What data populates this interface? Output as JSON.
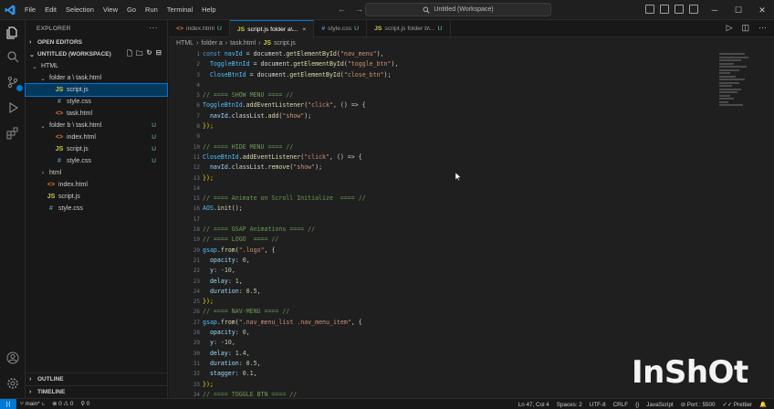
{
  "menu": [
    "File",
    "Edit",
    "Selection",
    "View",
    "Go",
    "Run",
    "Terminal",
    "Help"
  ],
  "command_center": "Untitled (Workspace)",
  "explorer": {
    "title": "EXPLORER",
    "open_editors": "OPEN EDITORS",
    "workspace": "UNTITLED (WORKSPACE)",
    "tree": [
      {
        "label": "HTML",
        "indent": 0,
        "chev": "⌄",
        "icon": "",
        "kind": "",
        "badge": ""
      },
      {
        "label": "folder a \\ task.html",
        "indent": 1,
        "chev": "⌄",
        "icon": "",
        "kind": "",
        "badge": ""
      },
      {
        "label": "script.js",
        "indent": 2,
        "chev": "",
        "icon": "JS",
        "kind": "js",
        "badge": "",
        "selected": true
      },
      {
        "label": "style.css",
        "indent": 2,
        "chev": "",
        "icon": "#",
        "kind": "css",
        "badge": ""
      },
      {
        "label": "task.html",
        "indent": 2,
        "chev": "",
        "icon": "<>",
        "kind": "html",
        "badge": ""
      },
      {
        "label": "folder b \\ task.html",
        "indent": 1,
        "chev": "⌄",
        "icon": "",
        "kind": "",
        "badge": "U"
      },
      {
        "label": "index.html",
        "indent": 2,
        "chev": "",
        "icon": "<>",
        "kind": "html",
        "badge": "U"
      },
      {
        "label": "script.js",
        "indent": 2,
        "chev": "",
        "icon": "JS",
        "kind": "js",
        "badge": "U"
      },
      {
        "label": "style.css",
        "indent": 2,
        "chev": "",
        "icon": "#",
        "kind": "css",
        "badge": "U"
      },
      {
        "label": "html",
        "indent": 1,
        "chev": "›",
        "icon": "",
        "kind": "",
        "badge": ""
      },
      {
        "label": "index.html",
        "indent": 1,
        "chev": "",
        "icon": "<>",
        "kind": "html",
        "badge": ""
      },
      {
        "label": "script.js",
        "indent": 1,
        "chev": "",
        "icon": "JS",
        "kind": "js",
        "badge": ""
      },
      {
        "label": "style.css",
        "indent": 1,
        "chev": "",
        "icon": "#",
        "kind": "css",
        "badge": ""
      }
    ],
    "outline": "OUTLINE",
    "timeline": "TIMELINE"
  },
  "tabs": [
    {
      "label": "index.html",
      "status": "U",
      "icon": "<>",
      "kind": "html",
      "active": false
    },
    {
      "label": "script.js  folder a\\...",
      "status": "",
      "icon": "JS",
      "kind": "js",
      "active": true
    },
    {
      "label": "style.css",
      "status": "U",
      "icon": "#",
      "kind": "css",
      "active": false
    },
    {
      "label": "script.js  folder b\\...",
      "status": "U",
      "icon": "JS",
      "kind": "js",
      "active": false
    }
  ],
  "breadcrumb": [
    "HTML",
    "folder a",
    "task.html",
    "script.js"
  ],
  "code": [
    [
      [
        "kw",
        "const "
      ],
      [
        "var",
        "navId"
      ],
      [
        "punc",
        " = document."
      ],
      [
        "fn",
        "getElementById"
      ],
      [
        "punc",
        "("
      ],
      [
        "str",
        "\"nav_menu\""
      ],
      [
        "punc",
        "),"
      ]
    ],
    [
      [
        "punc",
        "  "
      ],
      [
        "var",
        "ToggleBtnId"
      ],
      [
        "punc",
        " = document."
      ],
      [
        "fn",
        "getElementById"
      ],
      [
        "punc",
        "("
      ],
      [
        "str",
        "\"toggle_btn\""
      ],
      [
        "punc",
        "),"
      ]
    ],
    [
      [
        "punc",
        "  "
      ],
      [
        "var",
        "CloseBtnId"
      ],
      [
        "punc",
        " = document."
      ],
      [
        "fn",
        "getElementById"
      ],
      [
        "punc",
        "("
      ],
      [
        "str",
        "\"close_btn\""
      ],
      [
        "punc",
        ");"
      ]
    ],
    [],
    [
      [
        "cmt",
        "// ==== SHOW MENU ==== //"
      ]
    ],
    [
      [
        "var",
        "ToggleBtnId"
      ],
      [
        "punc",
        "."
      ],
      [
        "fn",
        "addEventListener"
      ],
      [
        "punc",
        "("
      ],
      [
        "str",
        "\"click\""
      ],
      [
        "punc",
        ", () => {"
      ]
    ],
    [
      [
        "punc",
        "  "
      ],
      [
        "prop",
        "navId"
      ],
      [
        "punc",
        ".classList."
      ],
      [
        "fn",
        "add"
      ],
      [
        "punc",
        "("
      ],
      [
        "str",
        "\"show\""
      ],
      [
        "punc",
        ");"
      ]
    ],
    [
      [
        "ply",
        "});"
      ]
    ],
    [],
    [
      [
        "cmt",
        "// ==== HIDE MENU ==== //"
      ]
    ],
    [
      [
        "var",
        "CloseBtnId"
      ],
      [
        "punc",
        "."
      ],
      [
        "fn",
        "addEventListener"
      ],
      [
        "punc",
        "("
      ],
      [
        "str",
        "\"click\""
      ],
      [
        "punc",
        ", () => {"
      ]
    ],
    [
      [
        "punc",
        "  "
      ],
      [
        "prop",
        "navId"
      ],
      [
        "punc",
        ".classList."
      ],
      [
        "fn",
        "remove"
      ],
      [
        "punc",
        "("
      ],
      [
        "str",
        "\"show\""
      ],
      [
        "punc",
        ");"
      ]
    ],
    [
      [
        "ply",
        "});"
      ]
    ],
    [],
    [
      [
        "cmt",
        "// ==== Animate on Scroll Initialize  ==== //"
      ]
    ],
    [
      [
        "var",
        "AOS"
      ],
      [
        "punc",
        "."
      ],
      [
        "fn",
        "init"
      ],
      [
        "punc",
        "();"
      ]
    ],
    [],
    [
      [
        "cmt",
        "// ==== GSAP Animations ==== //"
      ]
    ],
    [
      [
        "cmt",
        "// ==== LOGO  ==== //"
      ]
    ],
    [
      [
        "var",
        "gsap"
      ],
      [
        "punc",
        "."
      ],
      [
        "fn",
        "from"
      ],
      [
        "punc",
        "("
      ],
      [
        "str",
        "\".logo\""
      ],
      [
        "punc",
        ", {"
      ]
    ],
    [
      [
        "punc",
        "  "
      ],
      [
        "prop",
        "opacity"
      ],
      [
        "punc",
        ": "
      ],
      [
        "num",
        "0"
      ],
      [
        "punc",
        ","
      ]
    ],
    [
      [
        "punc",
        "  "
      ],
      [
        "prop",
        "y"
      ],
      [
        "punc",
        ": "
      ],
      [
        "num",
        "-10"
      ],
      [
        "punc",
        ","
      ]
    ],
    [
      [
        "punc",
        "  "
      ],
      [
        "prop",
        "delay"
      ],
      [
        "punc",
        ": "
      ],
      [
        "num",
        "1"
      ],
      [
        "punc",
        ","
      ]
    ],
    [
      [
        "punc",
        "  "
      ],
      [
        "prop",
        "duration"
      ],
      [
        "punc",
        ": "
      ],
      [
        "num",
        "0.5"
      ],
      [
        "punc",
        ","
      ]
    ],
    [
      [
        "ply",
        "});"
      ]
    ],
    [
      [
        "cmt",
        "// ==== NAV-MENU ==== //"
      ]
    ],
    [
      [
        "var",
        "gsap"
      ],
      [
        "punc",
        "."
      ],
      [
        "fn",
        "from"
      ],
      [
        "punc",
        "("
      ],
      [
        "str",
        "\".nav_menu_list .nav_menu_item\""
      ],
      [
        "punc",
        ", {"
      ]
    ],
    [
      [
        "punc",
        "  "
      ],
      [
        "prop",
        "opacity"
      ],
      [
        "punc",
        ": "
      ],
      [
        "num",
        "0"
      ],
      [
        "punc",
        ","
      ]
    ],
    [
      [
        "punc",
        "  "
      ],
      [
        "prop",
        "y"
      ],
      [
        "punc",
        ": "
      ],
      [
        "num",
        "-10"
      ],
      [
        "punc",
        ","
      ]
    ],
    [
      [
        "punc",
        "  "
      ],
      [
        "prop",
        "delay"
      ],
      [
        "punc",
        ": "
      ],
      [
        "num",
        "1.4"
      ],
      [
        "punc",
        ","
      ]
    ],
    [
      [
        "punc",
        "  "
      ],
      [
        "prop",
        "duration"
      ],
      [
        "punc",
        ": "
      ],
      [
        "num",
        "0.5"
      ],
      [
        "punc",
        ","
      ]
    ],
    [
      [
        "punc",
        "  "
      ],
      [
        "prop",
        "stagger"
      ],
      [
        "punc",
        ": "
      ],
      [
        "num",
        "0.1"
      ],
      [
        "punc",
        ","
      ]
    ],
    [
      [
        "ply",
        "});"
      ]
    ],
    [
      [
        "cmt",
        "// ==== TOGGLE BTN ==== //"
      ]
    ]
  ],
  "status": {
    "branch": "main*",
    "errors": "0",
    "warnings": "0",
    "ports": "0",
    "position": "Ln 47, Col 4",
    "spaces": "Spaces: 2",
    "encoding": "UTF-8",
    "eol": "CRLF",
    "braces": "{}",
    "language": "JavaScript",
    "port": "Port : 5500",
    "prettier": "Prettier"
  },
  "watermark": "InShOt"
}
